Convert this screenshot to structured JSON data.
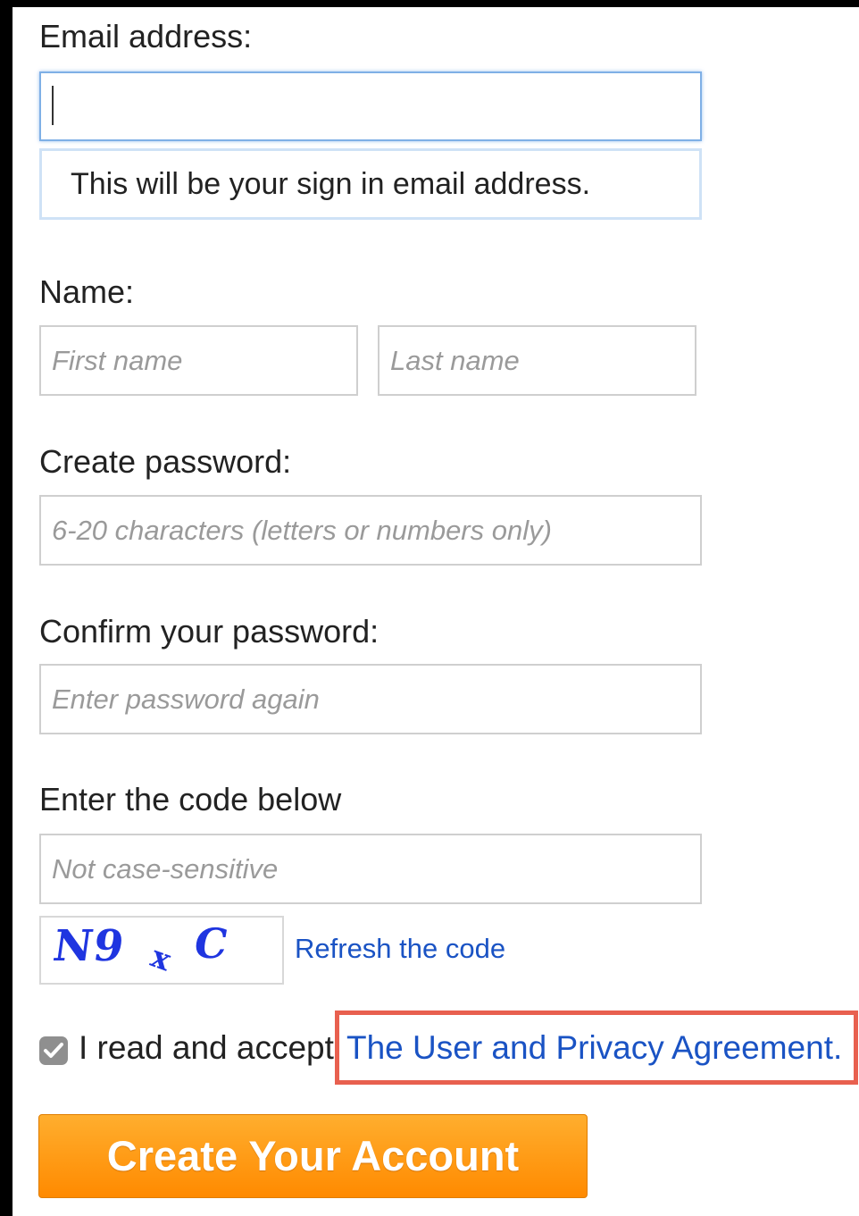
{
  "email": {
    "label": "Email address:",
    "value": "",
    "hint": "This will be your sign in email address."
  },
  "name": {
    "label": "Name:",
    "first_placeholder": "First name",
    "last_placeholder": "Last name"
  },
  "password": {
    "label": "Create password:",
    "placeholder": "6-20 characters (letters or numbers only)"
  },
  "confirm": {
    "label": "Confirm your password:",
    "placeholder": "Enter password again"
  },
  "code": {
    "label": "Enter the code below",
    "placeholder": "Not case-sensitive",
    "captcha_text": "N9",
    "captcha_small": "x",
    "captcha_end": "C",
    "refresh_link": "Refresh the code"
  },
  "agreement": {
    "checked": true,
    "text": "I read and accept",
    "link": "The User and Privacy Agreement."
  },
  "submit": {
    "label": "Create Your Account"
  },
  "colors": {
    "accent": "#ff9a0f",
    "link": "#1a53c4",
    "highlight": "#e8604f"
  }
}
